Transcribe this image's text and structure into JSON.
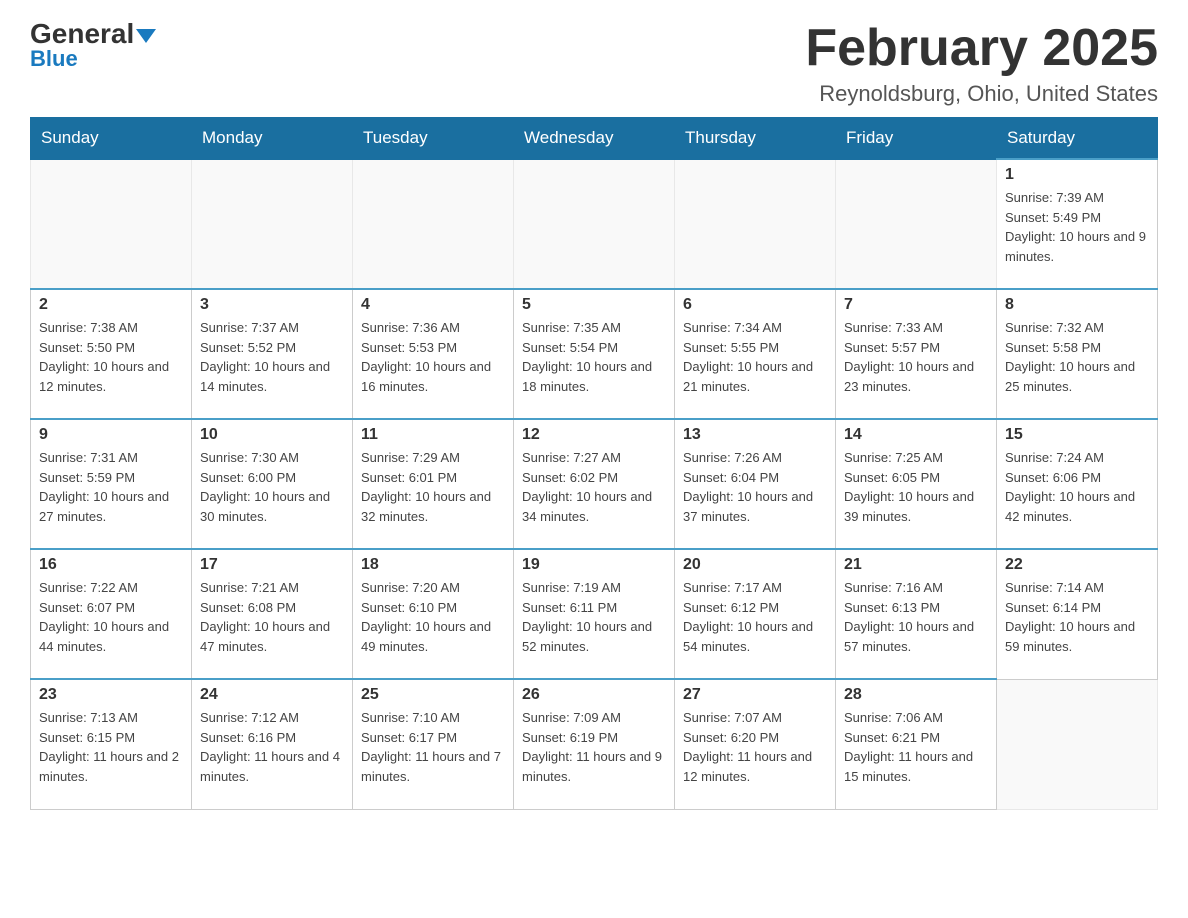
{
  "header": {
    "logo_main": "General",
    "logo_sub": "Blue",
    "title": "February 2025",
    "location": "Reynoldsburg, Ohio, United States"
  },
  "weekdays": [
    "Sunday",
    "Monday",
    "Tuesday",
    "Wednesday",
    "Thursday",
    "Friday",
    "Saturday"
  ],
  "weeks": [
    [
      {
        "day": "",
        "info": ""
      },
      {
        "day": "",
        "info": ""
      },
      {
        "day": "",
        "info": ""
      },
      {
        "day": "",
        "info": ""
      },
      {
        "day": "",
        "info": ""
      },
      {
        "day": "",
        "info": ""
      },
      {
        "day": "1",
        "info": "Sunrise: 7:39 AM\nSunset: 5:49 PM\nDaylight: 10 hours and 9 minutes."
      }
    ],
    [
      {
        "day": "2",
        "info": "Sunrise: 7:38 AM\nSunset: 5:50 PM\nDaylight: 10 hours and 12 minutes."
      },
      {
        "day": "3",
        "info": "Sunrise: 7:37 AM\nSunset: 5:52 PM\nDaylight: 10 hours and 14 minutes."
      },
      {
        "day": "4",
        "info": "Sunrise: 7:36 AM\nSunset: 5:53 PM\nDaylight: 10 hours and 16 minutes."
      },
      {
        "day": "5",
        "info": "Sunrise: 7:35 AM\nSunset: 5:54 PM\nDaylight: 10 hours and 18 minutes."
      },
      {
        "day": "6",
        "info": "Sunrise: 7:34 AM\nSunset: 5:55 PM\nDaylight: 10 hours and 21 minutes."
      },
      {
        "day": "7",
        "info": "Sunrise: 7:33 AM\nSunset: 5:57 PM\nDaylight: 10 hours and 23 minutes."
      },
      {
        "day": "8",
        "info": "Sunrise: 7:32 AM\nSunset: 5:58 PM\nDaylight: 10 hours and 25 minutes."
      }
    ],
    [
      {
        "day": "9",
        "info": "Sunrise: 7:31 AM\nSunset: 5:59 PM\nDaylight: 10 hours and 27 minutes."
      },
      {
        "day": "10",
        "info": "Sunrise: 7:30 AM\nSunset: 6:00 PM\nDaylight: 10 hours and 30 minutes."
      },
      {
        "day": "11",
        "info": "Sunrise: 7:29 AM\nSunset: 6:01 PM\nDaylight: 10 hours and 32 minutes."
      },
      {
        "day": "12",
        "info": "Sunrise: 7:27 AM\nSunset: 6:02 PM\nDaylight: 10 hours and 34 minutes."
      },
      {
        "day": "13",
        "info": "Sunrise: 7:26 AM\nSunset: 6:04 PM\nDaylight: 10 hours and 37 minutes."
      },
      {
        "day": "14",
        "info": "Sunrise: 7:25 AM\nSunset: 6:05 PM\nDaylight: 10 hours and 39 minutes."
      },
      {
        "day": "15",
        "info": "Sunrise: 7:24 AM\nSunset: 6:06 PM\nDaylight: 10 hours and 42 minutes."
      }
    ],
    [
      {
        "day": "16",
        "info": "Sunrise: 7:22 AM\nSunset: 6:07 PM\nDaylight: 10 hours and 44 minutes."
      },
      {
        "day": "17",
        "info": "Sunrise: 7:21 AM\nSunset: 6:08 PM\nDaylight: 10 hours and 47 minutes."
      },
      {
        "day": "18",
        "info": "Sunrise: 7:20 AM\nSunset: 6:10 PM\nDaylight: 10 hours and 49 minutes."
      },
      {
        "day": "19",
        "info": "Sunrise: 7:19 AM\nSunset: 6:11 PM\nDaylight: 10 hours and 52 minutes."
      },
      {
        "day": "20",
        "info": "Sunrise: 7:17 AM\nSunset: 6:12 PM\nDaylight: 10 hours and 54 minutes."
      },
      {
        "day": "21",
        "info": "Sunrise: 7:16 AM\nSunset: 6:13 PM\nDaylight: 10 hours and 57 minutes."
      },
      {
        "day": "22",
        "info": "Sunrise: 7:14 AM\nSunset: 6:14 PM\nDaylight: 10 hours and 59 minutes."
      }
    ],
    [
      {
        "day": "23",
        "info": "Sunrise: 7:13 AM\nSunset: 6:15 PM\nDaylight: 11 hours and 2 minutes."
      },
      {
        "day": "24",
        "info": "Sunrise: 7:12 AM\nSunset: 6:16 PM\nDaylight: 11 hours and 4 minutes."
      },
      {
        "day": "25",
        "info": "Sunrise: 7:10 AM\nSunset: 6:17 PM\nDaylight: 11 hours and 7 minutes."
      },
      {
        "day": "26",
        "info": "Sunrise: 7:09 AM\nSunset: 6:19 PM\nDaylight: 11 hours and 9 minutes."
      },
      {
        "day": "27",
        "info": "Sunrise: 7:07 AM\nSunset: 6:20 PM\nDaylight: 11 hours and 12 minutes."
      },
      {
        "day": "28",
        "info": "Sunrise: 7:06 AM\nSunset: 6:21 PM\nDaylight: 11 hours and 15 minutes."
      },
      {
        "day": "",
        "info": ""
      }
    ]
  ]
}
